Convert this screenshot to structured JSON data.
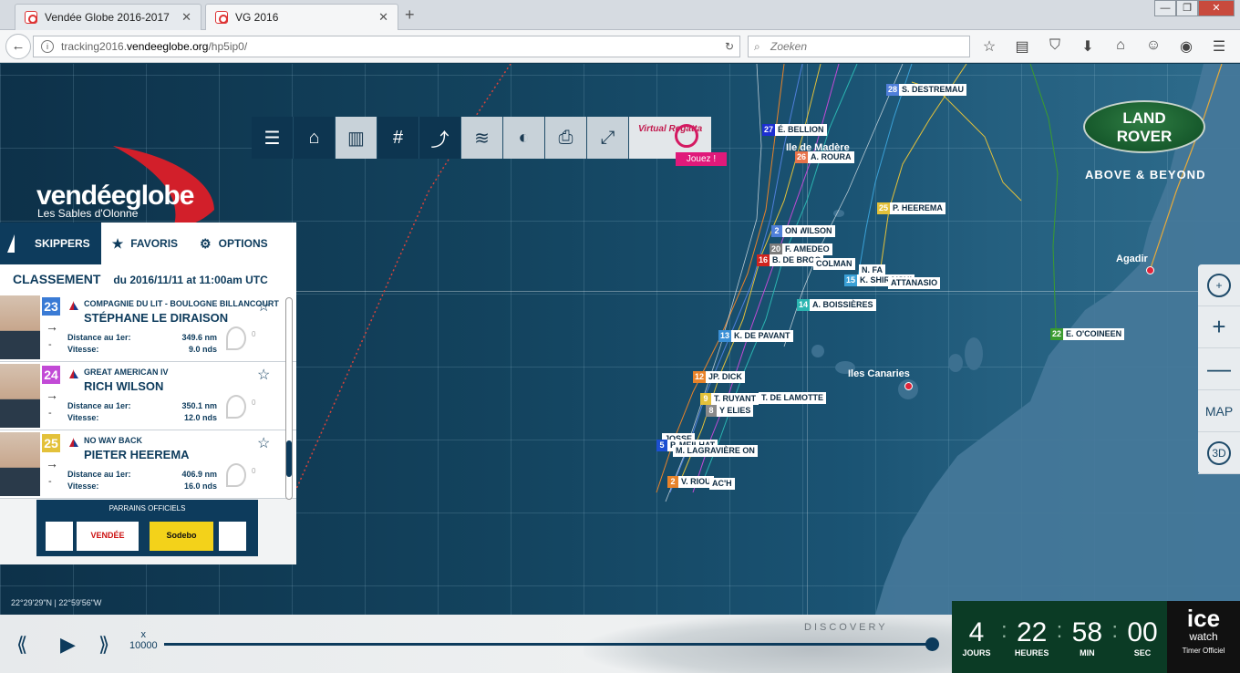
{
  "browser": {
    "tabs": [
      {
        "title": "Vendée Globe 2016-2017",
        "active": false
      },
      {
        "title": "VG 2016",
        "active": true
      }
    ],
    "url_prefix": "tracking2016.",
    "url_domain": "vendeeglobe.org",
    "url_path": "/hp5ip0/",
    "search_placeholder": "Zoeken"
  },
  "brand": {
    "logo_word": "vendéeglobe",
    "logo_sub": "Les Sables d'Olonne",
    "sponsor_tagline": "ABOVE & BEYOND",
    "sponsor_logo_line1": "LAND",
    "sponsor_logo_line2": "ROVER"
  },
  "toolbar": {
    "virtual_regatta": "Virtual Regatta",
    "jouez": "Jouez !"
  },
  "map": {
    "places": {
      "madere": "Ile de Madère",
      "canaries": "Iles Canaries",
      "agadir": "Agadir"
    },
    "coords": "22°29'29\"N | 22°59'56\"W"
  },
  "boats": [
    {
      "num": "28",
      "name": "S. DESTREMAU",
      "color": "#4f7fd9"
    },
    {
      "num": "27",
      "name": "É. BELLION",
      "color": "#1c2fd1"
    },
    {
      "num": "26",
      "name": "A. ROURA",
      "color": "#e8734a"
    },
    {
      "num": "25",
      "name": "P. HEEREMA",
      "color": "#e3c13a"
    },
    {
      "num": "24",
      "name": "R. WILSON",
      "color": "#c24ad6"
    },
    {
      "num": "20",
      "name": "F. AMEDEO",
      "color": "#7d7d7d"
    },
    {
      "num": "16",
      "name": "B. DE BROC",
      "color": "#d1231e"
    },
    {
      "num": "",
      "name": "COLMAN",
      "color": "#ffffff"
    },
    {
      "num": "",
      "name": "N. FA",
      "color": "#ffffff"
    },
    {
      "num": "15",
      "name": "K. SHIRAISHI",
      "color": "#3aa0d6"
    },
    {
      "num": "",
      "name": "ATTANASIO",
      "color": "#ffffff"
    },
    {
      "num": "14",
      "name": "A. BOISSIÈRES",
      "color": "#2bb5b1"
    },
    {
      "num": "13",
      "name": "K. DE PAVANT",
      "color": "#3a8fd6"
    },
    {
      "num": "22",
      "name": "E. O'COINEEN",
      "color": "#3b9b2f"
    },
    {
      "num": "12",
      "name": "JP. DICK",
      "color": "#e8832a"
    },
    {
      "num": "9",
      "name": "T. RUYANT",
      "color": "#e3c13a"
    },
    {
      "num": "",
      "name": "T. DE LAMOTTE",
      "color": "#ffffff"
    },
    {
      "num": "8",
      "name": "Y ELIES",
      "color": "#8a8a8a"
    },
    {
      "num": "",
      "name": "JOSSE",
      "color": "#ffffff"
    },
    {
      "num": "5",
      "name": "P. MEILHAT",
      "color": "#1c4fd1"
    },
    {
      "num": "",
      "name": "M. LAGRAVIÈRE ON",
      "color": "#ffffff"
    },
    {
      "num": "2",
      "name": "V. RIOU",
      "color": "#e8832a"
    },
    {
      "num": "",
      "name": "AC'H",
      "color": "#ffffff"
    },
    {
      "num": "2",
      "name": "ON",
      "color": "#4f7fd9"
    }
  ],
  "panel": {
    "tabs": [
      "SKIPPERS",
      "FAVORIS",
      "OPTIONS"
    ],
    "classement": "CLASSEMENT",
    "classement_date": "du 2016/11/11 at 11:00am UTC",
    "label_distance": "Distance au 1er:",
    "label_vitesse": "Vitesse:",
    "skippers": [
      {
        "rank": "23",
        "rank_color": "#3a7bd5",
        "boat": "COMPAGNIE DU LIT - BOULOGNE BILLANCOURT",
        "name": "STÉPHANE LE DIRAISON",
        "distance": "349.6 nm",
        "vitesse": "9.0 nds",
        "count": "0"
      },
      {
        "rank": "24",
        "rank_color": "#c24ad6",
        "boat": "GREAT AMERICAN IV",
        "name": "RICH WILSON",
        "distance": "350.1 nm",
        "vitesse": "12.0 nds",
        "count": "0"
      },
      {
        "rank": "25",
        "rank_color": "#e3c13a",
        "boat": "NO WAY BACK",
        "name": "PIETER HEEREMA",
        "distance": "406.9 nm",
        "vitesse": "16.0 nds",
        "count": "0"
      }
    ],
    "sponsors_title": "PARRAINS OFFICIELS",
    "sponsor_vendee": "VENDÉE",
    "sponsor_sodebo": "Sodebo"
  },
  "controls": {
    "map": "MAP",
    "threed": "3D"
  },
  "playback": {
    "speed_x": "x",
    "speed": "10000"
  },
  "car_badge": "DISCOVERY",
  "timer": {
    "jours": "4",
    "heures": "22",
    "min": "58",
    "sec": "00",
    "jours_label": "JOURS",
    "heures_label": "HEURES",
    "min_label": "MIN",
    "sec_label": "SEC"
  },
  "icewatch": {
    "line1": "ice",
    "line2": "watch",
    "line3": "Timer Officiel"
  }
}
